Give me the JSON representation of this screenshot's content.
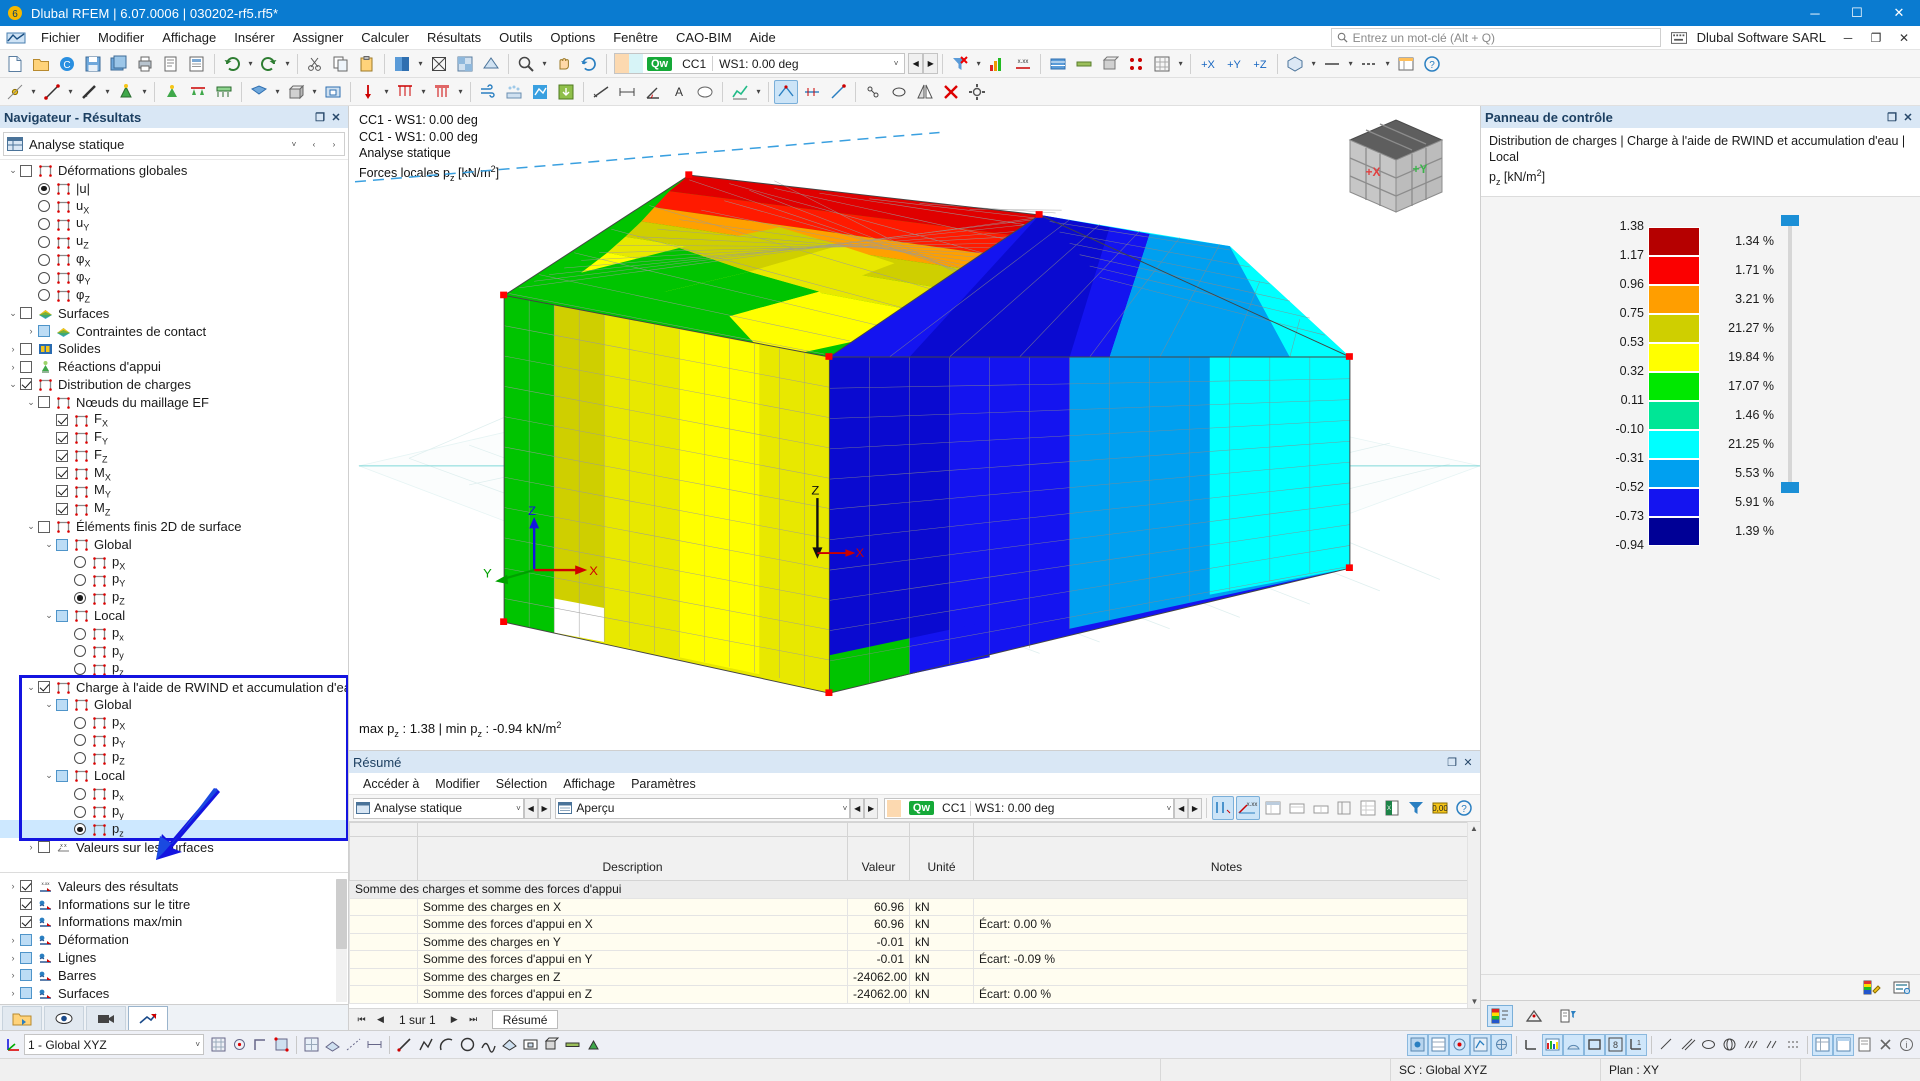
{
  "window": {
    "title": "Dlubal RFEM | 6.07.0006 | 030202-rf5.rf5*",
    "app_icon": "dlubal-logo-icon",
    "minimize": "─",
    "maximize": "☐",
    "close": "✕"
  },
  "menubar": {
    "items": [
      "Fichier",
      "Modifier",
      "Affichage",
      "Insérer",
      "Assigner",
      "Calculer",
      "Résultats",
      "Outils",
      "Options",
      "Fenêtre",
      "CAO-BIM",
      "Aide"
    ],
    "search_placeholder": "Entrez un mot-clé (Alt + Q)",
    "company": "Dlubal Software SARL",
    "win_minimize": "─",
    "win_restore": "❐",
    "win_close": "✕"
  },
  "toolbar": {
    "load_case": {
      "qw_badge": "Qw",
      "case": "CC1",
      "wind": "WS1: 0.00 deg",
      "caret": "˅",
      "prev": "◀",
      "next": "▶"
    }
  },
  "navigator": {
    "title": "Navigateur - Résultats",
    "pin": "❐",
    "close": "✕",
    "selector": {
      "label": "Analyse statique",
      "icon": "analysis-icon",
      "caret": "˅",
      "prev": "‹",
      "next": "›"
    },
    "tree": [
      {
        "id": "deformations-globales",
        "label": "Déformations globales",
        "indent": 0,
        "expander": "⌄",
        "control": "check",
        "checked": false,
        "icon": "member-icon"
      },
      {
        "id": "u-abs",
        "label": "|u|",
        "indent": 1,
        "expander": "",
        "control": "radio",
        "checked": true,
        "icon": "member-icon"
      },
      {
        "id": "ux",
        "label": "u",
        "sub": "X",
        "indent": 1,
        "expander": "",
        "control": "radio",
        "checked": false,
        "icon": "member-icon"
      },
      {
        "id": "uy",
        "label": "u",
        "sub": "Y",
        "indent": 1,
        "expander": "",
        "control": "radio",
        "checked": false,
        "icon": "member-icon"
      },
      {
        "id": "uz",
        "label": "u",
        "sub": "Z",
        "indent": 1,
        "expander": "",
        "control": "radio",
        "checked": false,
        "icon": "member-icon"
      },
      {
        "id": "phix",
        "label": "φ",
        "sub": "X",
        "indent": 1,
        "expander": "",
        "control": "radio",
        "checked": false,
        "icon": "member-icon"
      },
      {
        "id": "phiy",
        "label": "φ",
        "sub": "Y",
        "indent": 1,
        "expander": "",
        "control": "radio",
        "checked": false,
        "icon": "member-icon"
      },
      {
        "id": "phiz",
        "label": "φ",
        "sub": "Z",
        "indent": 1,
        "expander": "",
        "control": "radio",
        "checked": false,
        "icon": "member-icon"
      },
      {
        "id": "surfaces",
        "label": "Surfaces",
        "indent": 0,
        "expander": "⌄",
        "control": "check",
        "checked": false,
        "icon": "surface-icon"
      },
      {
        "id": "contraintes-de-contact",
        "label": "Contraintes de contact",
        "indent": 1,
        "expander": "›",
        "control": "check",
        "checked": false,
        "blue": true,
        "icon": "surface-icon"
      },
      {
        "id": "solides",
        "label": "Solides",
        "indent": 0,
        "expander": "›",
        "control": "check",
        "checked": false,
        "icon": "solid-icon"
      },
      {
        "id": "reactions-dappui",
        "label": "Réactions d'appui",
        "indent": 0,
        "expander": "›",
        "control": "check",
        "checked": false,
        "icon": "support-icon"
      },
      {
        "id": "distribution-de-charges",
        "label": "Distribution de charges",
        "indent": 0,
        "expander": "⌄",
        "control": "check",
        "checked": true,
        "icon": "member-icon"
      },
      {
        "id": "noeuds-du-maillage-ef",
        "label": "Nœuds du maillage EF",
        "indent": 1,
        "expander": "⌄",
        "control": "check",
        "checked": false,
        "icon": "member-icon"
      },
      {
        "id": "fx",
        "label": "F",
        "sub": "X",
        "indent": 2,
        "expander": "",
        "control": "check",
        "checked": true,
        "icon": "member-icon"
      },
      {
        "id": "fy",
        "label": "F",
        "sub": "Y",
        "indent": 2,
        "expander": "",
        "control": "check",
        "checked": true,
        "icon": "member-icon"
      },
      {
        "id": "fz",
        "label": "F",
        "sub": "Z",
        "indent": 2,
        "expander": "",
        "control": "check",
        "checked": true,
        "icon": "member-icon"
      },
      {
        "id": "mx",
        "label": "M",
        "sub": "X",
        "indent": 2,
        "expander": "",
        "control": "check",
        "checked": true,
        "icon": "member-icon"
      },
      {
        "id": "my",
        "label": "M",
        "sub": "Y",
        "indent": 2,
        "expander": "",
        "control": "check",
        "checked": true,
        "icon": "member-icon"
      },
      {
        "id": "mz",
        "label": "M",
        "sub": "Z",
        "indent": 2,
        "expander": "",
        "control": "check",
        "checked": true,
        "icon": "member-icon"
      },
      {
        "id": "elements-finis-2d-de-surface",
        "label": "Éléments finis 2D de surface",
        "indent": 1,
        "expander": "⌄",
        "control": "check",
        "checked": false,
        "icon": "member-icon"
      },
      {
        "id": "global-1",
        "label": "Global",
        "indent": 2,
        "expander": "⌄",
        "control": "check",
        "checked": false,
        "blue": true,
        "icon": "member-icon"
      },
      {
        "id": "global-1-px",
        "label": "p",
        "sub": "X",
        "indent": 3,
        "expander": "",
        "control": "radio",
        "checked": false,
        "icon": "member-icon"
      },
      {
        "id": "global-1-py",
        "label": "p",
        "sub": "Y",
        "indent": 3,
        "expander": "",
        "control": "radio",
        "checked": false,
        "icon": "member-icon"
      },
      {
        "id": "global-1-pz",
        "label": "p",
        "sub": "Z",
        "indent": 3,
        "expander": "",
        "control": "radio",
        "checked": true,
        "icon": "member-icon"
      },
      {
        "id": "local-1",
        "label": "Local",
        "indent": 2,
        "expander": "⌄",
        "control": "check",
        "checked": false,
        "blue": true,
        "icon": "member-icon"
      },
      {
        "id": "local-1-px",
        "label": "p",
        "sub": "x",
        "indent": 3,
        "expander": "",
        "control": "radio",
        "checked": false,
        "icon": "member-icon"
      },
      {
        "id": "local-1-py",
        "label": "p",
        "sub": "y",
        "indent": 3,
        "expander": "",
        "control": "radio",
        "checked": false,
        "icon": "member-icon"
      },
      {
        "id": "local-1-pz",
        "label": "p",
        "sub": "z",
        "indent": 3,
        "expander": "",
        "control": "radio",
        "checked": false,
        "icon": "member-icon"
      },
      {
        "id": "charge-rwind",
        "label": "Charge à l'aide de RWIND et accumulation d'eau",
        "indent": 1,
        "expander": "⌄",
        "control": "check",
        "checked": true,
        "icon": "member-icon"
      },
      {
        "id": "global-2",
        "label": "Global",
        "indent": 2,
        "expander": "⌄",
        "control": "check",
        "checked": false,
        "blue": true,
        "icon": "member-icon"
      },
      {
        "id": "global-2-px",
        "label": "p",
        "sub": "X",
        "indent": 3,
        "expander": "",
        "control": "radio",
        "checked": false,
        "icon": "member-icon"
      },
      {
        "id": "global-2-py",
        "label": "p",
        "sub": "Y",
        "indent": 3,
        "expander": "",
        "control": "radio",
        "checked": false,
        "icon": "member-icon"
      },
      {
        "id": "global-2-pz",
        "label": "p",
        "sub": "Z",
        "indent": 3,
        "expander": "",
        "control": "radio",
        "checked": false,
        "icon": "member-icon"
      },
      {
        "id": "local-2",
        "label": "Local",
        "indent": 2,
        "expander": "⌄",
        "control": "check",
        "checked": false,
        "blue": true,
        "icon": "member-icon"
      },
      {
        "id": "local-2-px",
        "label": "p",
        "sub": "x",
        "indent": 3,
        "expander": "",
        "control": "radio",
        "checked": false,
        "icon": "member-icon"
      },
      {
        "id": "local-2-py",
        "label": "p",
        "sub": "y",
        "indent": 3,
        "expander": "",
        "control": "radio",
        "checked": false,
        "icon": "member-icon"
      },
      {
        "id": "local-2-pz",
        "label": "p",
        "sub": "z",
        "indent": 3,
        "expander": "",
        "control": "radio",
        "checked": true,
        "selected": true,
        "icon": "member-icon"
      },
      {
        "id": "valeurs-sur-les-surfaces",
        "label": "Valeurs sur les surfaces",
        "indent": 1,
        "expander": "›",
        "control": "check",
        "checked": false,
        "icon": "values-icon"
      }
    ],
    "tree_lower": [
      {
        "id": "valeurs-des-resultats",
        "label": "Valeurs des résultats",
        "expander": "›",
        "control": "check",
        "checked": true,
        "icon": "result-values-icon"
      },
      {
        "id": "informations-sur-le-titre",
        "label": "Informations sur le titre",
        "expander": "",
        "control": "check",
        "checked": true,
        "icon": "title-info-icon"
      },
      {
        "id": "informations-max-min",
        "label": "Informations max/min",
        "expander": "",
        "control": "check",
        "checked": true,
        "icon": "maxmin-icon"
      },
      {
        "id": "deformation",
        "label": "Déformation",
        "expander": "›",
        "control": "check",
        "checked": false,
        "blue": true,
        "icon": "deformation-icon"
      },
      {
        "id": "lignes",
        "label": "Lignes",
        "expander": "›",
        "control": "check",
        "checked": false,
        "blue": true,
        "icon": "lines-icon"
      },
      {
        "id": "barres",
        "label": "Barres",
        "expander": "›",
        "control": "check",
        "checked": false,
        "blue": true,
        "icon": "members-icon"
      },
      {
        "id": "surfaces-2",
        "label": "Surfaces",
        "expander": "›",
        "control": "check",
        "checked": false,
        "blue": true,
        "icon": "surfaces-icon"
      }
    ],
    "tabs": [
      {
        "id": "tab-project",
        "icon": "project-navigator-icon",
        "active": false
      },
      {
        "id": "tab-display",
        "icon": "eye-icon",
        "active": false
      },
      {
        "id": "tab-views",
        "icon": "camera-icon",
        "active": false
      },
      {
        "id": "tab-results",
        "icon": "results-icon",
        "active": true
      }
    ]
  },
  "viewport": {
    "header_lines": [
      "CC1 - WS1: 0.00 deg",
      "CC1 - WS1: 0.00 deg",
      "Analyse statique"
    ],
    "quantity_prefix": "Forces locales p",
    "quantity_sub": "z",
    "quantity_unit": " [kN/m",
    "quantity_sup": "2",
    "quantity_close": "]",
    "minmax": "max p",
    "minmax_sub1": "z",
    "minmax_mid": " : 1.38 | min p",
    "minmax_sub2": "z",
    "minmax_end": " : -0.94 kN/m",
    "minmax_sup": "2",
    "navcube": {
      "plus_x": "+X",
      "plus_y": "+Y"
    },
    "axis_triad": {
      "x": "X",
      "y": "Y",
      "z": "Z"
    },
    "origin_axis": {
      "x": "X",
      "z": "Z"
    }
  },
  "control_panel": {
    "title": "Panneau de contrôle",
    "pin": "❐",
    "close": "✕",
    "subtitle_line1": "Distribution de charges | Charge à l'aide de RWIND et accumulation d'eau | Local",
    "subtitle_quantity": "p",
    "subtitle_sub": "z",
    "subtitle_unit": " [kN/m",
    "subtitle_sup": "2",
    "subtitle_close": "]",
    "tabs": [
      {
        "id": "cp-tab-color-scale",
        "icon": "color-scale-icon",
        "active": true
      },
      {
        "id": "cp-tab-factors",
        "icon": "factors-icon",
        "active": false
      },
      {
        "id": "cp-tab-filter",
        "icon": "filter-icon",
        "active": false
      }
    ],
    "footer_buttons": [
      {
        "id": "cp-btn-edit-scale",
        "icon": "edit-scale-icon"
      },
      {
        "id": "cp-btn-scale-options",
        "icon": "scale-options-icon"
      }
    ]
  },
  "chart_data": {
    "type": "bar",
    "title": "Distribution de charges | Charge à l'aide de RWIND et accumulation d'eau | Local",
    "ylabel": "pz [kN/m2]",
    "legend_position": "right",
    "boundaries": [
      1.38,
      1.17,
      0.96,
      0.75,
      0.53,
      0.32,
      0.11,
      -0.1,
      -0.31,
      -0.52,
      -0.73,
      -0.94
    ],
    "categories": [
      "1.17–1.38",
      "0.96–1.17",
      "0.75–0.96",
      "0.53–0.75",
      "0.32–0.53",
      "0.11–0.32",
      "-0.10–0.11",
      "-0.31–-0.10",
      "-0.52–-0.31",
      "-0.73–-0.52",
      "-0.94–-0.73"
    ],
    "values": [
      1.34,
      1.71,
      3.21,
      21.27,
      19.84,
      17.07,
      1.46,
      21.25,
      5.53,
      5.91,
      1.39
    ],
    "value_labels": [
      "1.34 %",
      "1.71 %",
      "3.21 %",
      "21.27 %",
      "19.84 %",
      "17.07 %",
      "1.46 %",
      "21.25 %",
      "5.53 %",
      "5.91 %",
      "1.39 %"
    ],
    "colors": [
      "#b50000",
      "#fb0000",
      "#ff9e00",
      "#cfcf00",
      "#ffff00",
      "#00e800",
      "#00e696",
      "#00ffff",
      "#00a0f0",
      "#1414f0",
      "#000096"
    ],
    "unit": "%",
    "ylim": [
      -0.94,
      1.38
    ],
    "max": 1.38,
    "min": -0.94
  },
  "bottom_panel": {
    "title": "Résumé",
    "pin": "❐",
    "close": "✕",
    "menu": [
      "Accéder à",
      "Modifier",
      "Sélection",
      "Affichage",
      "Paramètres"
    ],
    "combo_analysis": "Analyse statique",
    "combo_view": "Aperçu",
    "combo_case_qw": "Qw",
    "combo_case": "CC1",
    "combo_wind": "WS1: 0.00 deg",
    "caret": "˅",
    "prev": "◀",
    "next": "▶",
    "table": {
      "columns": [
        "",
        "Description",
        "Valeur",
        "Unité",
        "Notes"
      ],
      "group_row": "Somme des charges et somme des forces d'appui",
      "rows": [
        {
          "description": "Somme des charges en X",
          "value": "60.96",
          "unit": "kN",
          "notes": ""
        },
        {
          "description": "Somme des forces d'appui en X",
          "value": "60.96",
          "unit": "kN",
          "notes": "Écart: 0.00 %"
        },
        {
          "description": "Somme des charges en Y",
          "value": "-0.01",
          "unit": "kN",
          "notes": ""
        },
        {
          "description": "Somme des forces d'appui en Y",
          "value": "-0.01",
          "unit": "kN",
          "notes": "Écart: -0.09 %"
        },
        {
          "description": "Somme des charges en Z",
          "value": "-24062.00",
          "unit": "kN",
          "notes": ""
        },
        {
          "description": "Somme des forces d'appui en Z",
          "value": "-24062.00",
          "unit": "kN",
          "notes": "Écart: 0.00 %"
        }
      ]
    },
    "pager": {
      "first": "⏮",
      "prev": "◀",
      "label": "1 sur 1",
      "next": "▶",
      "last": "⏭"
    },
    "tab": "Résumé"
  },
  "statusbar": {
    "coord_system": "1 - Global XYZ",
    "caret": "˅",
    "sc_text": "SC : Global XYZ",
    "plan_text": "Plan : XY"
  }
}
